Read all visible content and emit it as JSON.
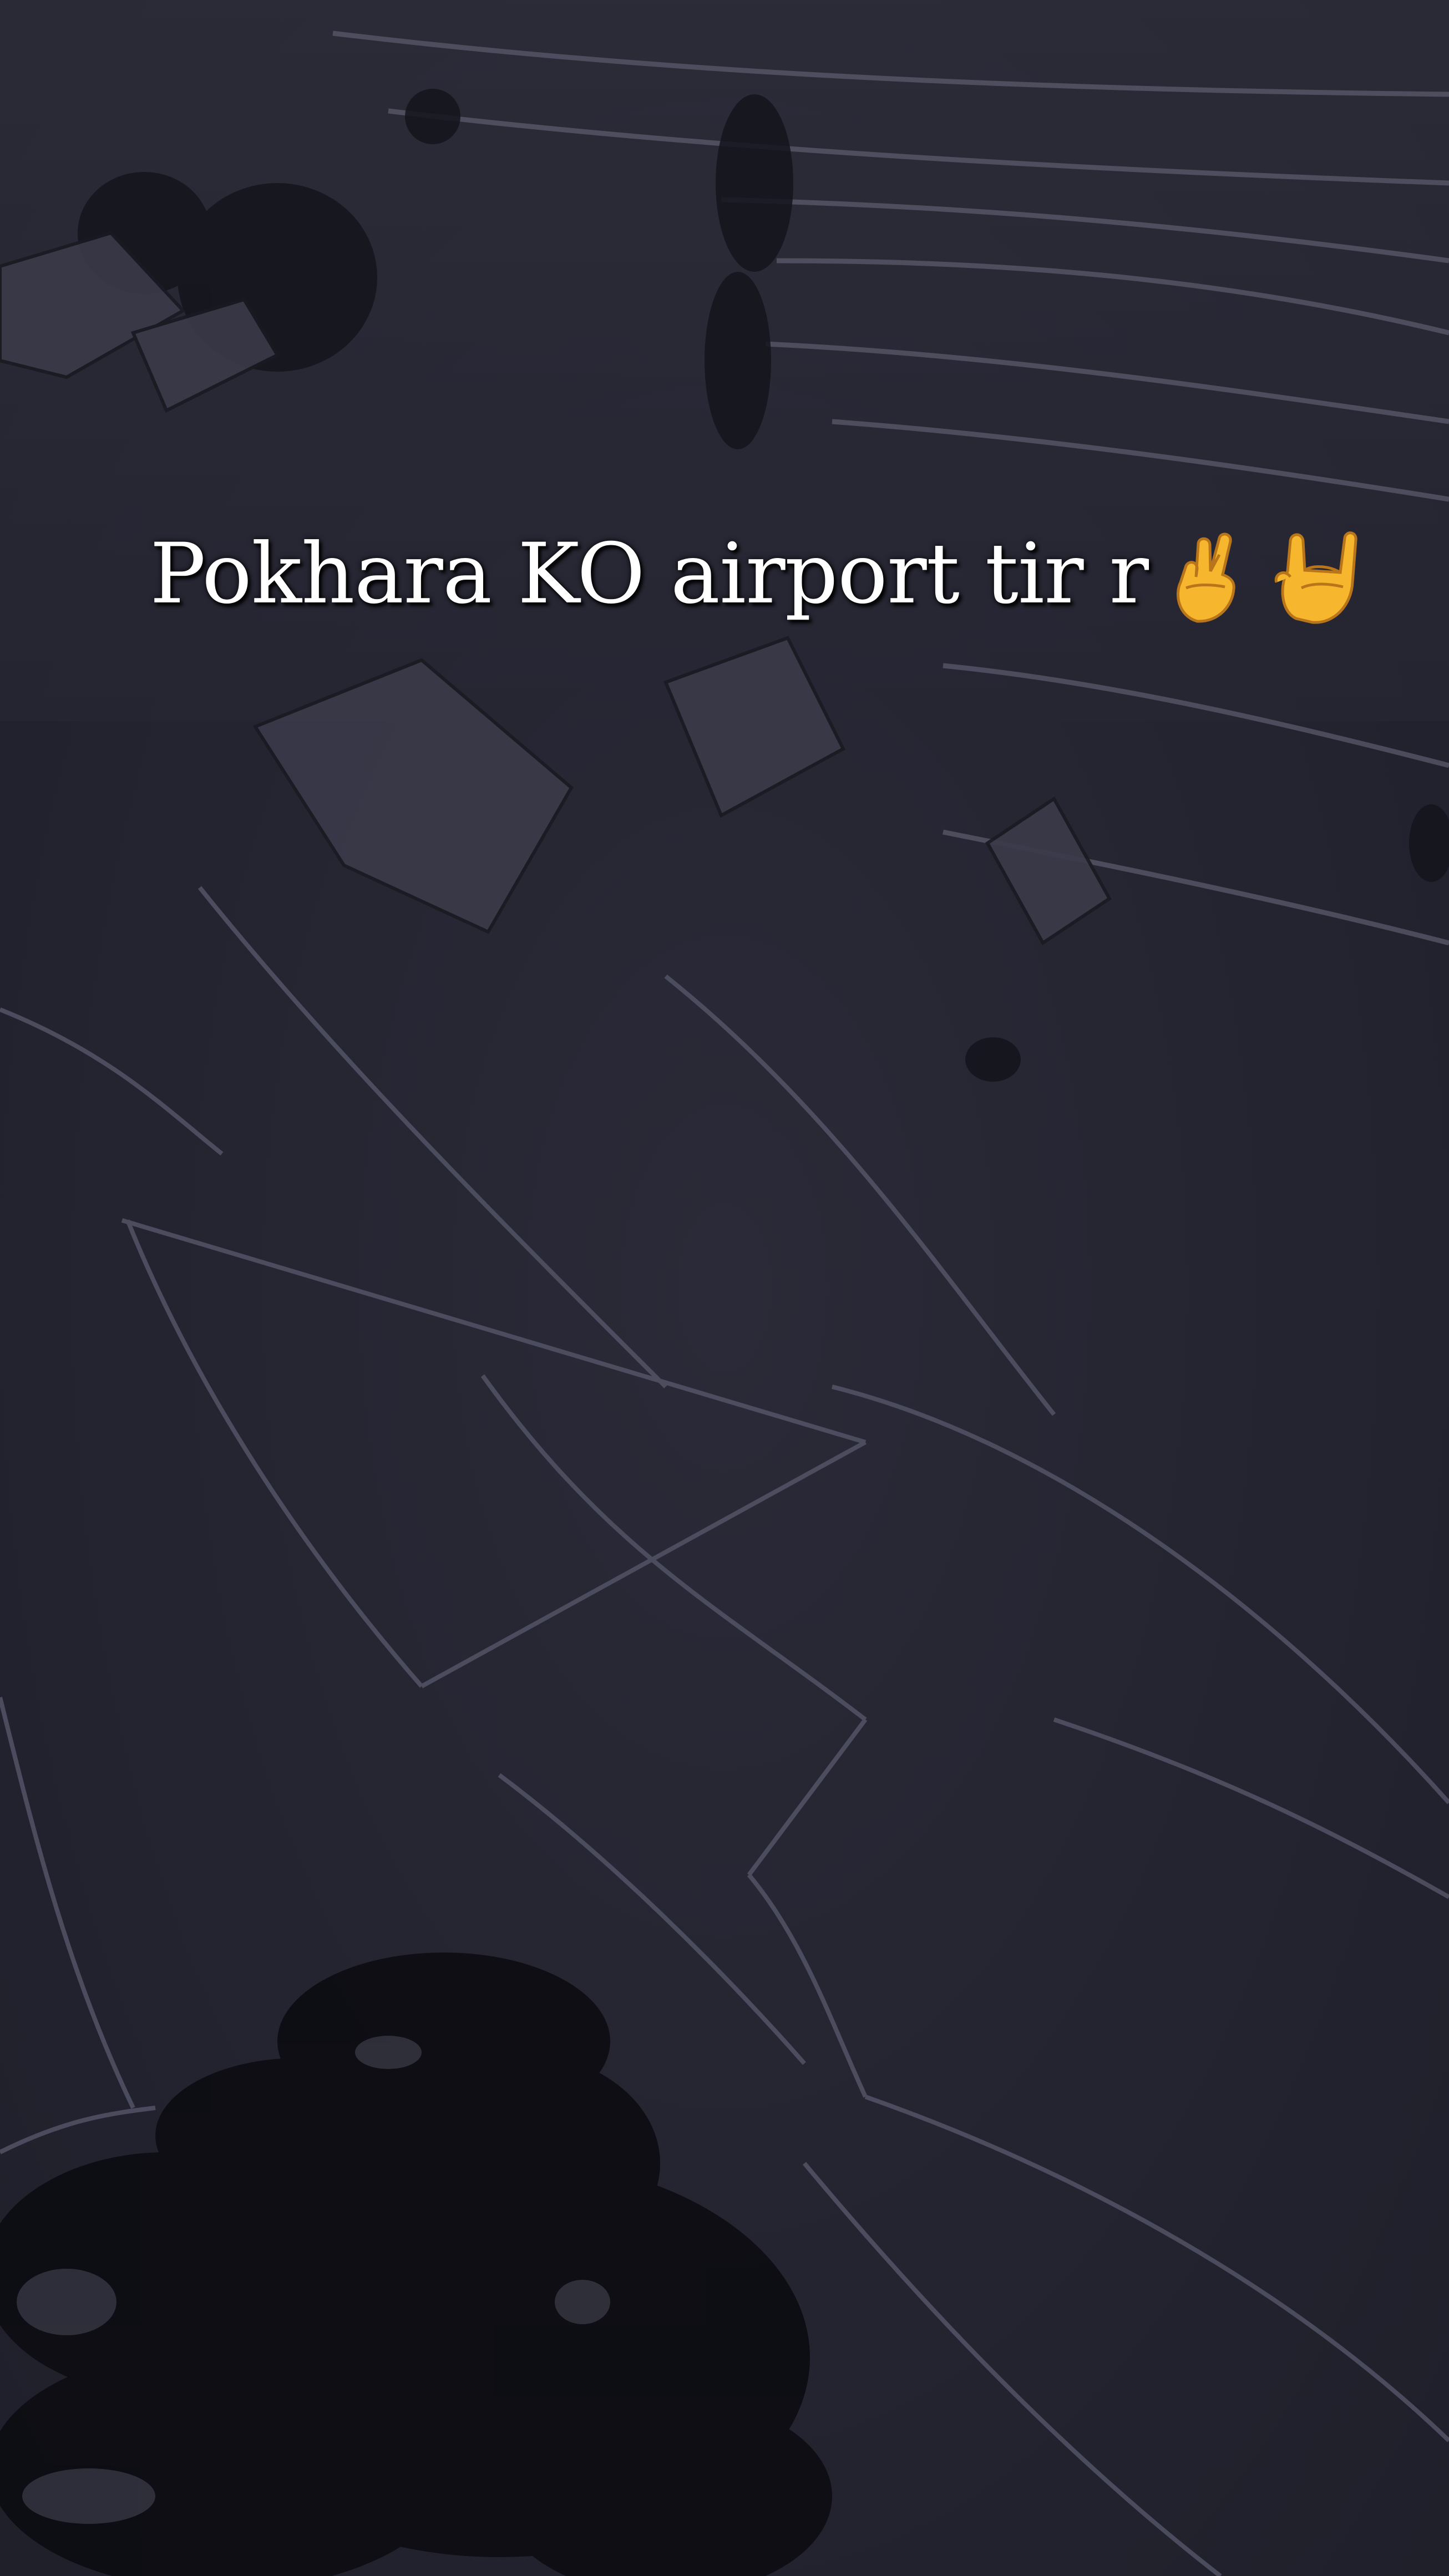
{
  "caption": {
    "text": "Pokhara KO airport tir r",
    "emojis": [
      "crossed-fingers-icon",
      "sign-of-the-horns-icon"
    ]
  },
  "scene": {
    "description_colors": {
      "overlay": "#262633",
      "field_lines": "#5c5c6e",
      "shadow": "#0f0f16",
      "emoji": "#f6b72e"
    }
  }
}
